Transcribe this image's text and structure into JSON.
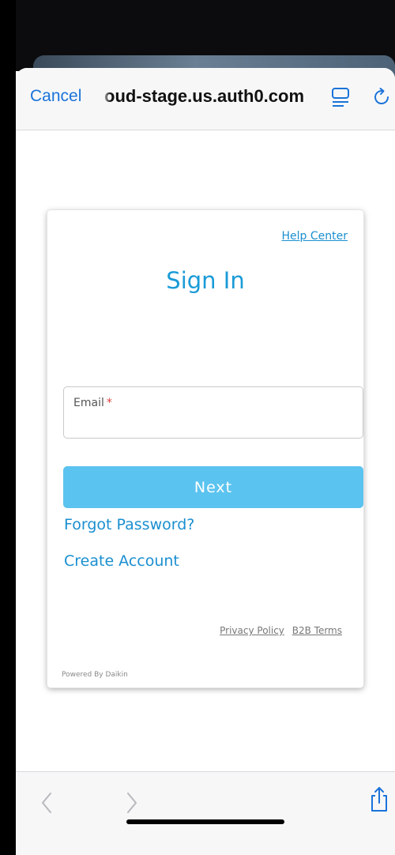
{
  "browser": {
    "cancel_label": "Cancel",
    "url": "oud-stage.us.auth0.com",
    "icons": {
      "reader": "reader-mode-icon",
      "reload": "reload-icon",
      "back": "chevron-left-icon",
      "forward": "chevron-right-icon",
      "share": "share-icon"
    },
    "accent_color": "#1a73d9"
  },
  "login": {
    "help_link": "Help Center",
    "title": "Sign In",
    "email_label": "Email",
    "required_mark": "*",
    "next_button": "Next",
    "forgot_password": "Forgot Password?",
    "create_account": "Create Account",
    "privacy_policy": "Privacy Policy",
    "b2b_terms": "B2B Terms",
    "powered_by": "Powered By Daikin",
    "brand_color": "#1a9bd7",
    "button_color": "#5bc3ef"
  }
}
